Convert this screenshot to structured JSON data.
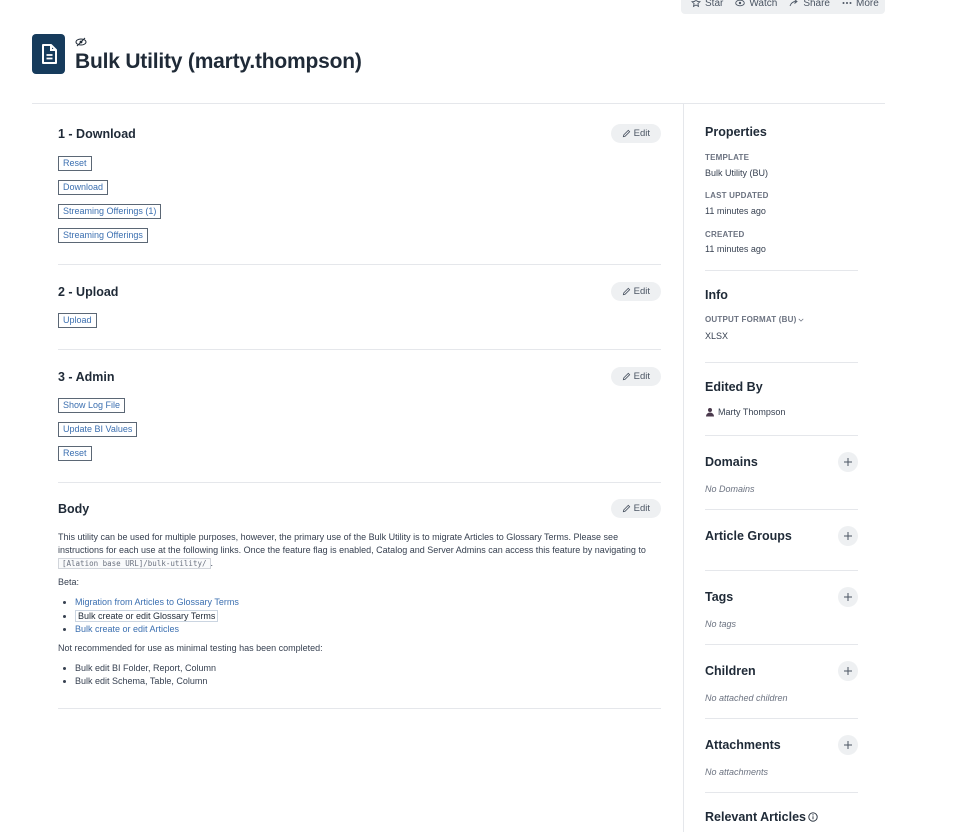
{
  "topbar": {
    "star": "Star",
    "watch": "Watch",
    "share": "Share",
    "more": "More"
  },
  "page": {
    "title": "Bulk Utility (marty.thompson)"
  },
  "sections": {
    "download": {
      "title": "1 - Download",
      "edit": "Edit",
      "buttons": [
        "Reset",
        "Download",
        "Streaming Offerings (1)",
        "Streaming Offerings"
      ]
    },
    "upload": {
      "title": "2 - Upload",
      "edit": "Edit",
      "buttons": [
        "Upload"
      ]
    },
    "admin": {
      "title": "3 - Admin",
      "edit": "Edit",
      "buttons": [
        "Show Log File",
        "Update BI Values",
        "Reset"
      ]
    },
    "body": {
      "title": "Body",
      "edit": "Edit",
      "para1": "This utility can be used for multiple purposes, however, the primary use of the Bulk Utility is to migrate Articles to Glossary Terms. Please see instructions for each use at the following links. Once the feature flag is enabled, Catalog and Server Admins can access this feature by navigating to",
      "code": "[Alation base URL]/bulk-utility/",
      "period": ".",
      "beta": "Beta:",
      "links": [
        "Migration from Articles to Glossary Terms",
        "Bulk create or edit Glossary Terms",
        "Bulk create or edit Articles"
      ],
      "not_recommended": "Not recommended for use as minimal testing has been completed:",
      "items": [
        "Bulk edit BI Folder, Report, Column",
        "Bulk edit Schema, Table, Column"
      ]
    }
  },
  "sidebar": {
    "properties": {
      "title": "Properties",
      "template_label": "TEMPLATE",
      "template_value": "Bulk Utility (BU)",
      "updated_label": "LAST UPDATED",
      "updated_value": "11 minutes ago",
      "created_label": "CREATED",
      "created_value": "11 minutes ago"
    },
    "info": {
      "title": "Info",
      "format_label": "OUTPUT FORMAT (BU)",
      "format_value": "XLSX"
    },
    "edited_by": {
      "title": "Edited By",
      "user": "Marty Thompson"
    },
    "domains": {
      "title": "Domains",
      "empty": "No Domains"
    },
    "article_groups": {
      "title": "Article Groups"
    },
    "tags": {
      "title": "Tags",
      "empty": "No tags"
    },
    "children": {
      "title": "Children",
      "empty": "No attached children"
    },
    "attachments": {
      "title": "Attachments",
      "empty": "No attachments"
    },
    "relevant_articles": {
      "title": "Relevant Articles"
    }
  },
  "colors": {
    "accent": "#163b5c",
    "link": "#3b6fb0",
    "chip_bg": "#eef0f2"
  }
}
